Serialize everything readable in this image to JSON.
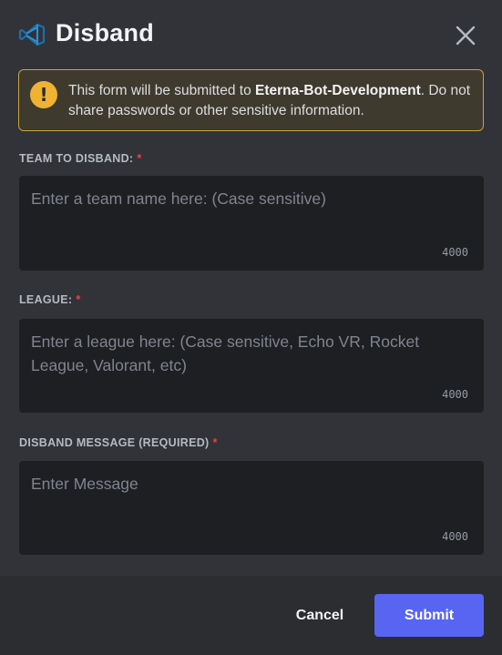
{
  "header": {
    "title": "Disband",
    "app_icon": "vscode-like-logo-icon",
    "close_icon": "close-icon"
  },
  "warning": {
    "icon": "exclamation-icon",
    "icon_glyph": "!",
    "text_before": "This form will be submitted to ",
    "server_name": "Eterna-Bot-Development",
    "text_after": ". Do not share passwords or other sensitive information."
  },
  "fields": [
    {
      "label": "TEAM TO DISBAND:",
      "required_marker": "*",
      "placeholder": "Enter a team name here: (Case sensitive)",
      "counter": "4000"
    },
    {
      "label": "LEAGUE:",
      "required_marker": "*",
      "placeholder": "Enter a league here: (Case sensitive, Echo VR, Rocket League, Valorant, etc)",
      "counter": "4000"
    },
    {
      "label": "DISBAND MESSAGE (REQUIRED)",
      "required_marker": "*",
      "placeholder": "Enter Message",
      "counter": "4000"
    }
  ],
  "footer": {
    "cancel_label": "Cancel",
    "submit_label": "Submit"
  },
  "colors": {
    "background": "#313338",
    "footer": "#2b2d31",
    "input": "#1e1f22",
    "accent": "#5865f2",
    "warning_border": "#c8a43a",
    "warning_icon": "#f0b232",
    "required": "#f23f43"
  }
}
